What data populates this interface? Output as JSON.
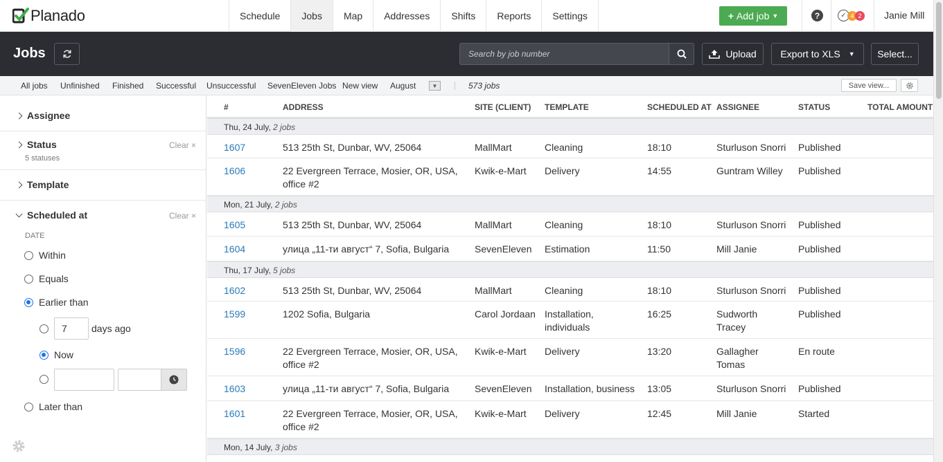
{
  "nav": {
    "logo": "Planado",
    "menu": [
      "Schedule",
      "Jobs",
      "Map",
      "Addresses",
      "Shifts",
      "Reports",
      "Settings"
    ],
    "add_job": "Add job",
    "help": "?",
    "notif_orange": "4",
    "notif_red": "2",
    "user": "Janie Mill"
  },
  "header": {
    "title": "Jobs",
    "search_placeholder": "Search by job number",
    "upload": "Upload",
    "export": "Export to XLS",
    "select": "Select..."
  },
  "views": {
    "items": [
      "All jobs",
      "Unfinished",
      "Finished",
      "Successful",
      "Unsuccessful",
      "SevenEleven Jobs",
      "New view",
      "August"
    ],
    "count": "573 jobs",
    "save_view": "Save view..."
  },
  "filters": {
    "assignee": "Assignee",
    "status": "Status",
    "status_sub": "5 statuses",
    "template": "Template",
    "scheduled_at": "Scheduled at",
    "clear": "Clear ×",
    "date_label": "DATE",
    "within": "Within",
    "equals": "Equals",
    "earlier_than": "Earlier than",
    "days_value": "7",
    "days_ago": "days ago",
    "now": "Now",
    "later_than": "Later than"
  },
  "table": {
    "columns": [
      "#",
      "ADDRESS",
      "SITE (CLIENT)",
      "TEMPLATE",
      "SCHEDULED AT",
      "ASSIGNEE",
      "STATUS",
      "TOTAL AMOUNT"
    ],
    "groups": [
      {
        "date": "Thu, 24 July, ",
        "count": "2 jobs"
      },
      {
        "date": "Mon, 21 July, ",
        "count": "2 jobs"
      },
      {
        "date": "Thu, 17 July, ",
        "count": "5 jobs"
      },
      {
        "date": "Mon, 14 July, ",
        "count": "3 jobs"
      }
    ],
    "rows": [
      {
        "id": "1607",
        "address": "513 25th St, Dunbar, WV, 25064",
        "site": "MallMart",
        "template": "Cleaning",
        "time": "18:10",
        "assignee": "Sturluson Snorri",
        "status": "Published"
      },
      {
        "id": "1606",
        "address": "22 Evergreen Terrace, Mosier, OR, USA, office #2",
        "site": "Kwik-e-Mart",
        "template": "Delivery",
        "time": "14:55",
        "assignee": "Guntram Willey",
        "status": "Published"
      },
      {
        "id": "1605",
        "address": "513 25th St, Dunbar, WV, 25064",
        "site": "MallMart",
        "template": "Cleaning",
        "time": "18:10",
        "assignee": "Sturluson Snorri",
        "status": "Published"
      },
      {
        "id": "1604",
        "address": "улица „11-ти август“ 7, Sofia, Bulgaria",
        "site": "SevenEleven",
        "template": "Estimation",
        "time": "11:50",
        "assignee": "Mill Janie",
        "status": "Published"
      },
      {
        "id": "1602",
        "address": "513 25th St, Dunbar, WV, 25064",
        "site": "MallMart",
        "template": "Cleaning",
        "time": "18:10",
        "assignee": "Sturluson Snorri",
        "status": "Published"
      },
      {
        "id": "1599",
        "address": "1202 Sofia, Bulgaria",
        "site": "Carol Jordaan",
        "template": "Installation, individuals",
        "time": "16:25",
        "assignee": "Sudworth Tracey",
        "status": "Published"
      },
      {
        "id": "1596",
        "address": "22 Evergreen Terrace, Mosier, OR, USA, office #2",
        "site": "Kwik-e-Mart",
        "template": "Delivery",
        "time": "13:20",
        "assignee": "Gallagher Tomas",
        "status": "En route"
      },
      {
        "id": "1603",
        "address": "улица „11-ти август“ 7, Sofia, Bulgaria",
        "site": "SevenEleven",
        "template": "Installation, business",
        "time": "13:05",
        "assignee": "Sturluson Snorri",
        "status": "Published"
      },
      {
        "id": "1601",
        "address": "22 Evergreen Terrace, Mosier, OR, USA, office #2",
        "site": "Kwik-e-Mart",
        "template": "Delivery",
        "time": "12:45",
        "assignee": "Mill Janie",
        "status": "Started"
      }
    ]
  },
  "colors": {
    "accent": "#4caa52",
    "header_bg": "#2b2d33",
    "link": "#2a7ab8",
    "radio": "#1a73e8"
  }
}
